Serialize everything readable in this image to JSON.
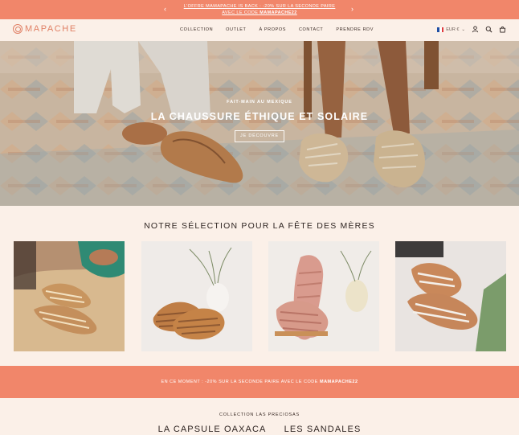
{
  "announcement": {
    "text_prefix": "L'offre Mamapache is back : -20% sur la seconde paire avec le code",
    "code": "MAMAPACHE22",
    "prev_icon": "chevron-left-icon",
    "next_icon": "chevron-right-icon"
  },
  "header": {
    "logo_text": "MAPACHE",
    "nav": [
      "Collection",
      "Outlet",
      "À Propos",
      "Contact",
      "Prendre RDV"
    ],
    "currency": "EUR €"
  },
  "hero": {
    "eyebrow": "Fait-main au Mexique",
    "title": "La chaussure éthique et solaire",
    "button": "Je découvre"
  },
  "selection": {
    "title": "Notre sélection pour la fête des mères"
  },
  "promo": {
    "text_prefix": "En ce moment : -20% sur la seconde paire avec le code",
    "code": "MAMAPACHE22"
  },
  "collections": {
    "eyebrow": "Collection Las Preciosas",
    "tabs": [
      "La Capsule Oaxaca",
      "Les Sandales"
    ]
  },
  "colors": {
    "accent": "#f1866a",
    "background": "#fbf0e8",
    "logo": "#e07f64"
  }
}
